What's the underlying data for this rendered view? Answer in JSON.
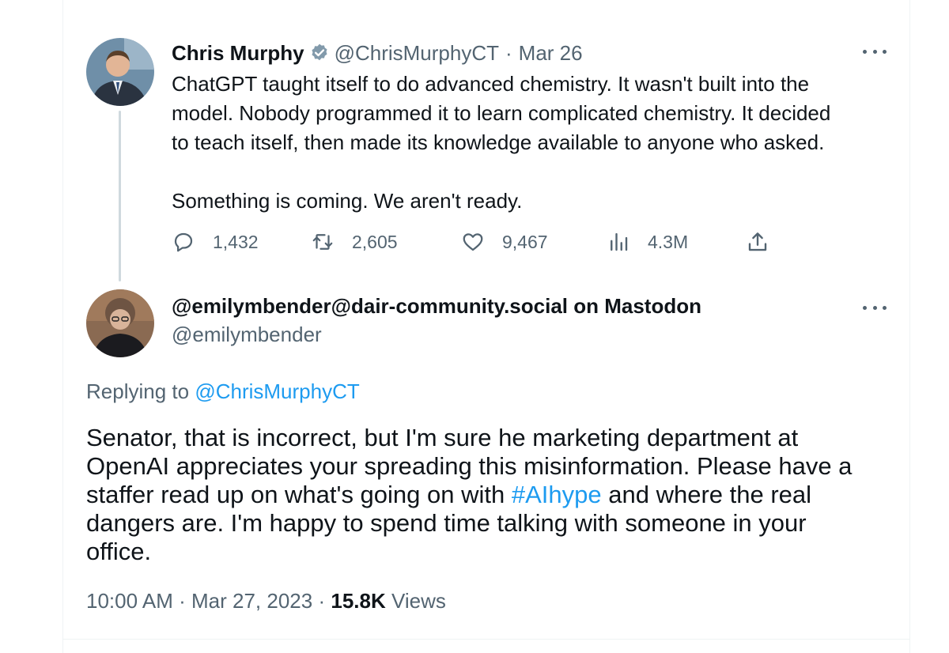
{
  "original_tweet": {
    "name": "Chris Murphy",
    "handle": "@ChrisMurphyCT",
    "separator": "·",
    "date": "Mar 26",
    "icons": {
      "verified": "verified-badge-icon",
      "more": "more-options-icon"
    },
    "text_lines": [
      "ChatGPT taught itself to do advanced chemistry. It wasn't built into the",
      "model. Nobody programmed it to learn complicated chemistry. It decided",
      "to teach itself, then made its knowledge available to anyone who asked."
    ],
    "text_second": "Something is coming. We aren't ready.",
    "stats": {
      "replies": "1,432",
      "retweets": "2,605",
      "likes": "9,467",
      "views": "4.3M"
    }
  },
  "reply_tweet": {
    "name": "@emilymbender@dair-community.social on Mastodon",
    "handle": "@emilymbender",
    "replying_prefix": "Replying to",
    "replying_handle": "@ChrisMurphyCT",
    "body_lines": [
      {
        "before": "Senator, that is incorrect, but I'm sure he marketing department at",
        "tag": "",
        "after": ""
      },
      {
        "before": "OpenAI appreciates your spreading this misinformation. Please have a",
        "tag": "",
        "after": ""
      },
      {
        "before": "staffer read up on what's going on with ",
        "tag": "#AIhype",
        "after": " and where the real"
      },
      {
        "before": "dangers are. I'm happy to spend time talking with someone in your",
        "tag": "",
        "after": ""
      },
      {
        "before": "office.",
        "tag": "",
        "after": ""
      }
    ],
    "time": "10:00 AM",
    "separator": "·",
    "date": "Mar 27, 2023",
    "views_count": "15.8K",
    "views_label": "Views"
  },
  "colors": {
    "text": "#0f1419",
    "muted": "#536471",
    "link": "#1d9bf0",
    "verified": "#829aab",
    "divider": "#eff3f4"
  }
}
